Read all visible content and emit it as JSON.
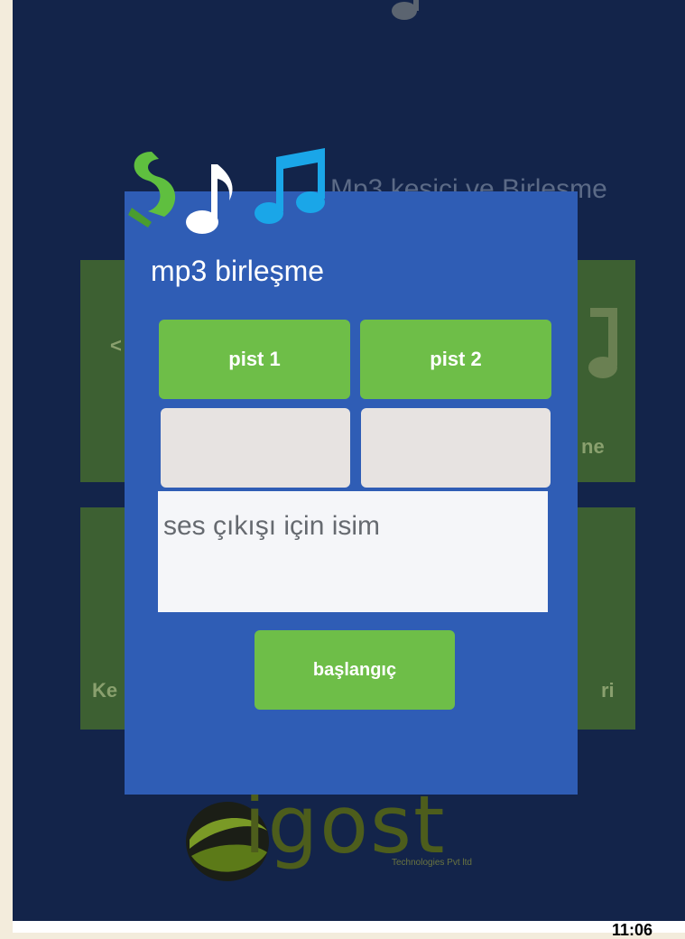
{
  "background": {
    "title": "Mp3 kesici ve Birleşme",
    "tile_left_top": "<",
    "tile_left_bottom": "Ke",
    "tile_right_top": "ne",
    "tile_right_bottom": "ri",
    "logo_text": "igost",
    "logo_sub": "Technologies Pvt ltd"
  },
  "dialog": {
    "title": "mp3 birleşme",
    "track1_label": "pist 1",
    "track2_label": "pist 2",
    "output_placeholder": "ses çıkışı için isim",
    "start_label": "başlangıç"
  },
  "status": {
    "clock": "11:06"
  },
  "colors": {
    "screen_bg": "#13244a",
    "dialog_bg": "#2f5db5",
    "button_green": "#6ebe48",
    "slot_gray": "#e7e3e1"
  }
}
